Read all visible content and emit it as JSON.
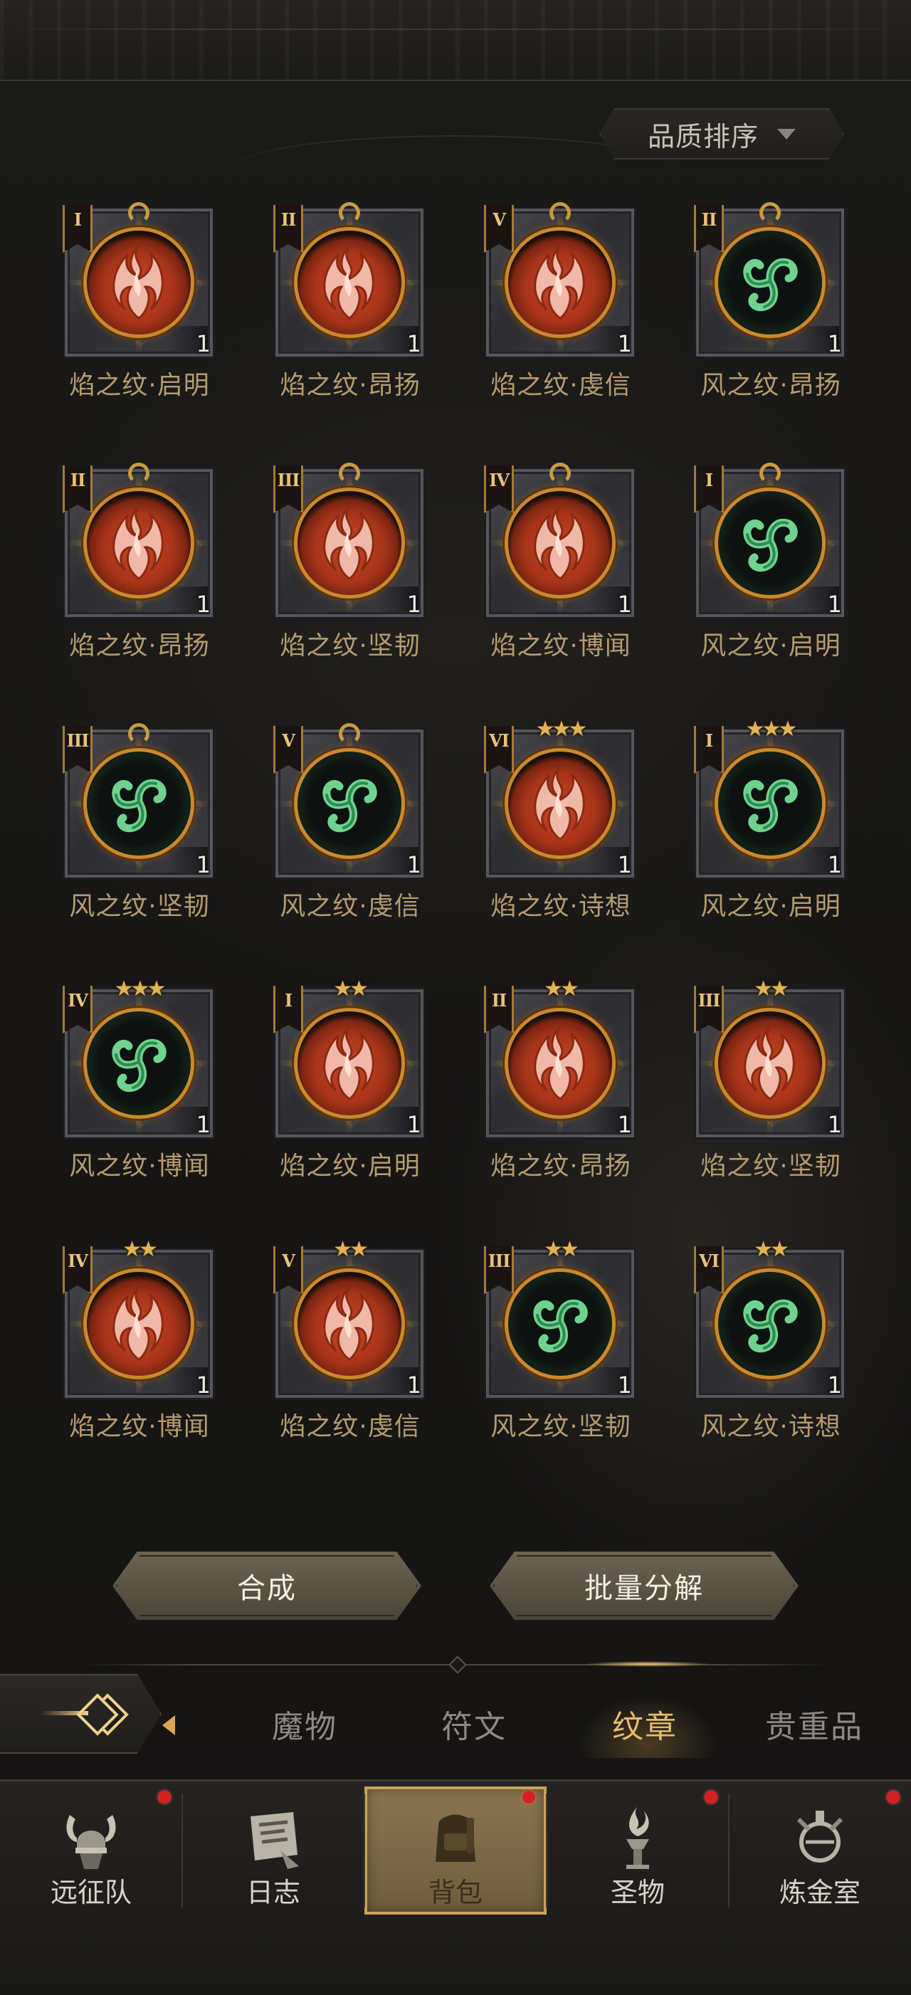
{
  "sort": {
    "label": "品质排序"
  },
  "items": [
    {
      "name": "焰之纹·启明",
      "type": "fire",
      "rank": "I",
      "top": "hook",
      "qty": "1"
    },
    {
      "name": "焰之纹·昂扬",
      "type": "fire",
      "rank": "II",
      "top": "hook",
      "qty": "1"
    },
    {
      "name": "焰之纹·虔信",
      "type": "fire",
      "rank": "V",
      "top": "hook",
      "qty": "1"
    },
    {
      "name": "风之纹·昂扬",
      "type": "wind",
      "rank": "II",
      "top": "hook",
      "qty": "1"
    },
    {
      "name": "焰之纹·昂扬",
      "type": "fire",
      "rank": "II",
      "top": "hook",
      "qty": "1"
    },
    {
      "name": "焰之纹·坚韧",
      "type": "fire",
      "rank": "III",
      "top": "hook",
      "qty": "1"
    },
    {
      "name": "焰之纹·博闻",
      "type": "fire",
      "rank": "IV",
      "top": "hook",
      "qty": "1"
    },
    {
      "name": "风之纹·启明",
      "type": "wind",
      "rank": "I",
      "top": "hook",
      "qty": "1"
    },
    {
      "name": "风之纹·坚韧",
      "type": "wind",
      "rank": "III",
      "top": "hook",
      "qty": "1"
    },
    {
      "name": "风之纹·虔信",
      "type": "wind",
      "rank": "V",
      "top": "hook",
      "qty": "1"
    },
    {
      "name": "焰之纹·诗想",
      "type": "fire",
      "rank": "VI",
      "top": "stars3",
      "qty": "1"
    },
    {
      "name": "风之纹·启明",
      "type": "wind",
      "rank": "I",
      "top": "stars3",
      "qty": "1"
    },
    {
      "name": "风之纹·博闻",
      "type": "wind",
      "rank": "IV",
      "top": "stars3",
      "qty": "1"
    },
    {
      "name": "焰之纹·启明",
      "type": "fire",
      "rank": "I",
      "top": "stars2",
      "qty": "1"
    },
    {
      "name": "焰之纹·昂扬",
      "type": "fire",
      "rank": "II",
      "top": "stars2",
      "qty": "1"
    },
    {
      "name": "焰之纹·坚韧",
      "type": "fire",
      "rank": "III",
      "top": "stars2",
      "qty": "1"
    },
    {
      "name": "焰之纹·博闻",
      "type": "fire",
      "rank": "IV",
      "top": "stars2",
      "qty": "1"
    },
    {
      "name": "焰之纹·虔信",
      "type": "fire",
      "rank": "V",
      "top": "stars2",
      "qty": "1"
    },
    {
      "name": "风之纹·坚韧",
      "type": "wind",
      "rank": "III",
      "top": "stars2",
      "qty": "1"
    },
    {
      "name": "风之纹·诗想",
      "type": "wind",
      "rank": "VI",
      "top": "stars2",
      "qty": "1"
    }
  ],
  "actions": {
    "compose": "合成",
    "batch_decompose": "批量分解"
  },
  "tabs": [
    {
      "label": "魔物",
      "active": false
    },
    {
      "label": "符文",
      "active": false
    },
    {
      "label": "纹章",
      "active": true
    },
    {
      "label": "贵重品",
      "active": false
    }
  ],
  "nav": [
    {
      "label": "远征队",
      "icon": "viking-helmet-icon",
      "badge": true,
      "active": false
    },
    {
      "label": "日志",
      "icon": "scroll-icon",
      "badge": false,
      "active": false
    },
    {
      "label": "背包",
      "icon": "backpack-icon",
      "badge": true,
      "active": true
    },
    {
      "label": "圣物",
      "icon": "relic-torch-icon",
      "badge": true,
      "active": false
    },
    {
      "label": "炼金室",
      "icon": "alchemy-icon",
      "badge": true,
      "active": false
    }
  ],
  "colors": {
    "accent_gold": "#e4bd6b",
    "fire": "#c94724",
    "wind": "#3fa35f",
    "badge_red": "#d42222"
  }
}
